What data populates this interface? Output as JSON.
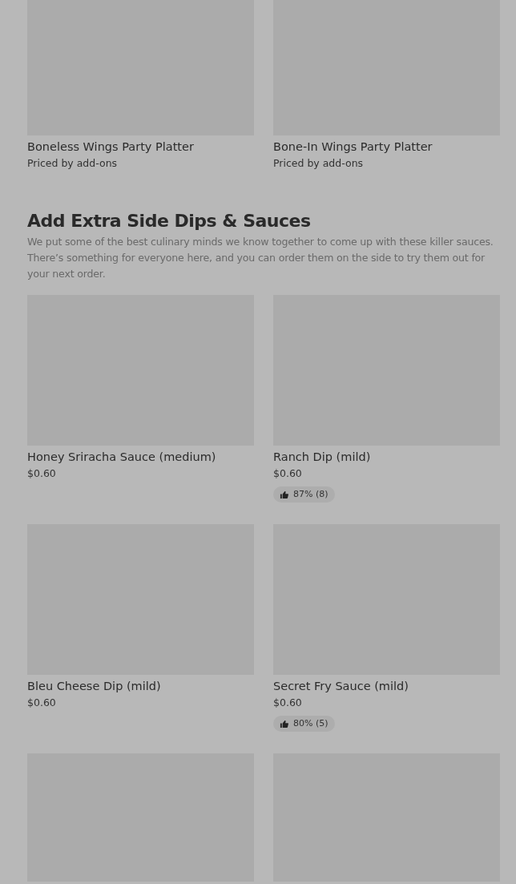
{
  "top_items": [
    {
      "kind": "item",
      "name": "Boneless Wings Party Platter",
      "price": "Priced by add-ons"
    },
    {
      "kind": "item",
      "name": "Bone-In Wings Party Platter",
      "price": "Priced by add-ons"
    }
  ],
  "section": {
    "title": "Add Extra Side Dips & Sauces",
    "description": "We put some of the best culinary minds we know together to come up with these killer sauces. There’s something for everyone here, and you can order them on the side to try them out for your next order.",
    "items": [
      {
        "kind": "item",
        "name": "Honey Sriracha Sauce (medium)",
        "price": "$0.60"
      },
      {
        "kind": "item",
        "name": "Ranch Dip (mild)",
        "price": "$0.60",
        "rating": "87% (8)"
      },
      {
        "kind": "item",
        "name": "Bleu Cheese Dip (mild)",
        "price": "$0.60"
      },
      {
        "kind": "item",
        "name": "Secret Fry Sauce (mild)",
        "price": "$0.60",
        "rating": "80% (5)"
      },
      {
        "kind": "picture"
      },
      {
        "kind": "picture"
      }
    ]
  }
}
